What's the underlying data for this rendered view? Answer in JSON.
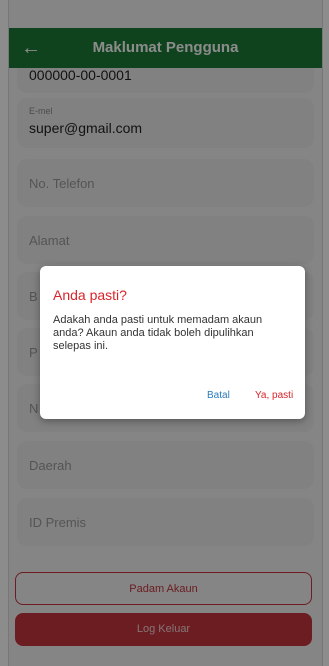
{
  "header": {
    "title": "Maklumat Pengguna",
    "back_icon": "arrow-left-icon"
  },
  "fields": {
    "ic_value": "000000-00-0001",
    "email": {
      "label": "E-mel",
      "value": "super@gmail.com"
    },
    "phone_placeholder": "No. Telefon",
    "address_placeholder": "Alamat",
    "field4_partial": "B",
    "field5_partial": "P",
    "field6_partial": "N",
    "district_placeholder": "Daerah",
    "premise_placeholder": "ID Premis"
  },
  "buttons": {
    "delete_account": "Padam Akaun",
    "logout": "Log Keluar"
  },
  "dialog": {
    "title": "Anda pasti?",
    "message": "Adakah anda pasti untuk memadam akaun anda? Akaun anda tidak boleh dipulihkan selepas ini.",
    "cancel": "Batal",
    "confirm": "Ya, pasti"
  },
  "colors": {
    "header": "#1a7a36",
    "danger": "#c4363e",
    "link_blue": "#2a7bbd"
  }
}
